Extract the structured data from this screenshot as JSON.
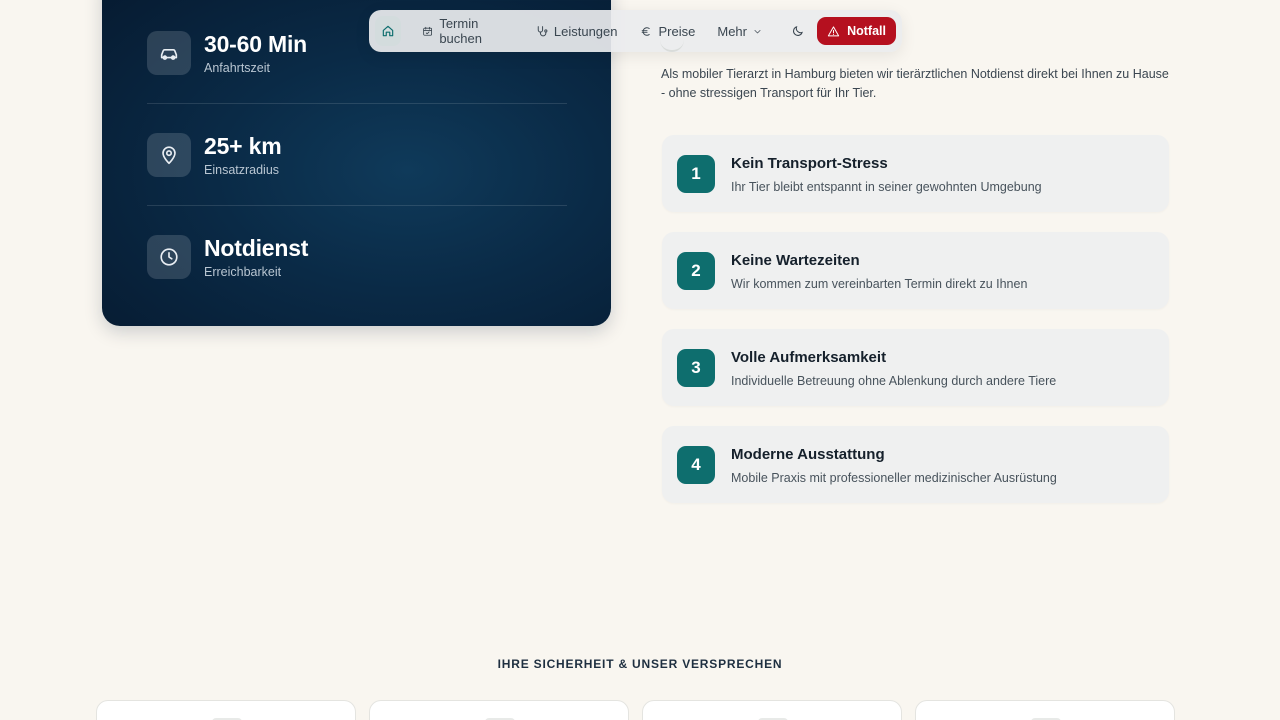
{
  "nav": {
    "home_icon": "home-icon",
    "items": [
      {
        "label": "Termin buchen",
        "icon": "calendar-icon"
      },
      {
        "label": "Leistungen",
        "icon": "stethoscope-icon"
      },
      {
        "label": "Preise",
        "icon": "euro-icon"
      },
      {
        "label": "Mehr",
        "icon": "chevron-down-icon"
      }
    ],
    "theme_icon": "moon-icon",
    "emergency": {
      "label": "Notfall",
      "icon": "warning-icon",
      "color": "#b5101f"
    }
  },
  "stats": [
    {
      "value": "30-60 Min",
      "label": "Anfahrtszeit",
      "icon": "car-icon"
    },
    {
      "value": "25+ km",
      "label": "Einsatzradius",
      "icon": "map-pin-icon"
    },
    {
      "value": "Notdienst",
      "label": "Erreichbarkeit",
      "icon": "clock-icon"
    }
  ],
  "intro": {
    "text": "Als mobiler Tierarzt in Hamburg bieten wir tierärztlichen Notdienst direkt bei Ihnen zu Hause - ohne stressigen Transport für Ihr Tier."
  },
  "benefits": [
    {
      "num": "1",
      "title": "Kein Transport-Stress",
      "desc": "Ihr Tier bleibt entspannt in seiner gewohnten Umgebung"
    },
    {
      "num": "2",
      "title": "Keine Wartezeiten",
      "desc": "Wir kommen zum vereinbarten Termin direkt zu Ihnen"
    },
    {
      "num": "3",
      "title": "Volle Aufmerksamkeit",
      "desc": "Individuelle Betreuung ohne Ablenkung durch andere Tiere"
    },
    {
      "num": "4",
      "title": "Moderne Ausstattung",
      "desc": "Mobile Praxis mit professioneller medizinischer Ausrüstung"
    }
  ],
  "promise": {
    "heading": "IHRE SICHERHEIT & UNSER VERSPRECHEN"
  },
  "colors": {
    "accent": "#0e6e6e",
    "navy": "#0a2a46",
    "emergency": "#b5101f",
    "background": "#f9f6f0"
  }
}
